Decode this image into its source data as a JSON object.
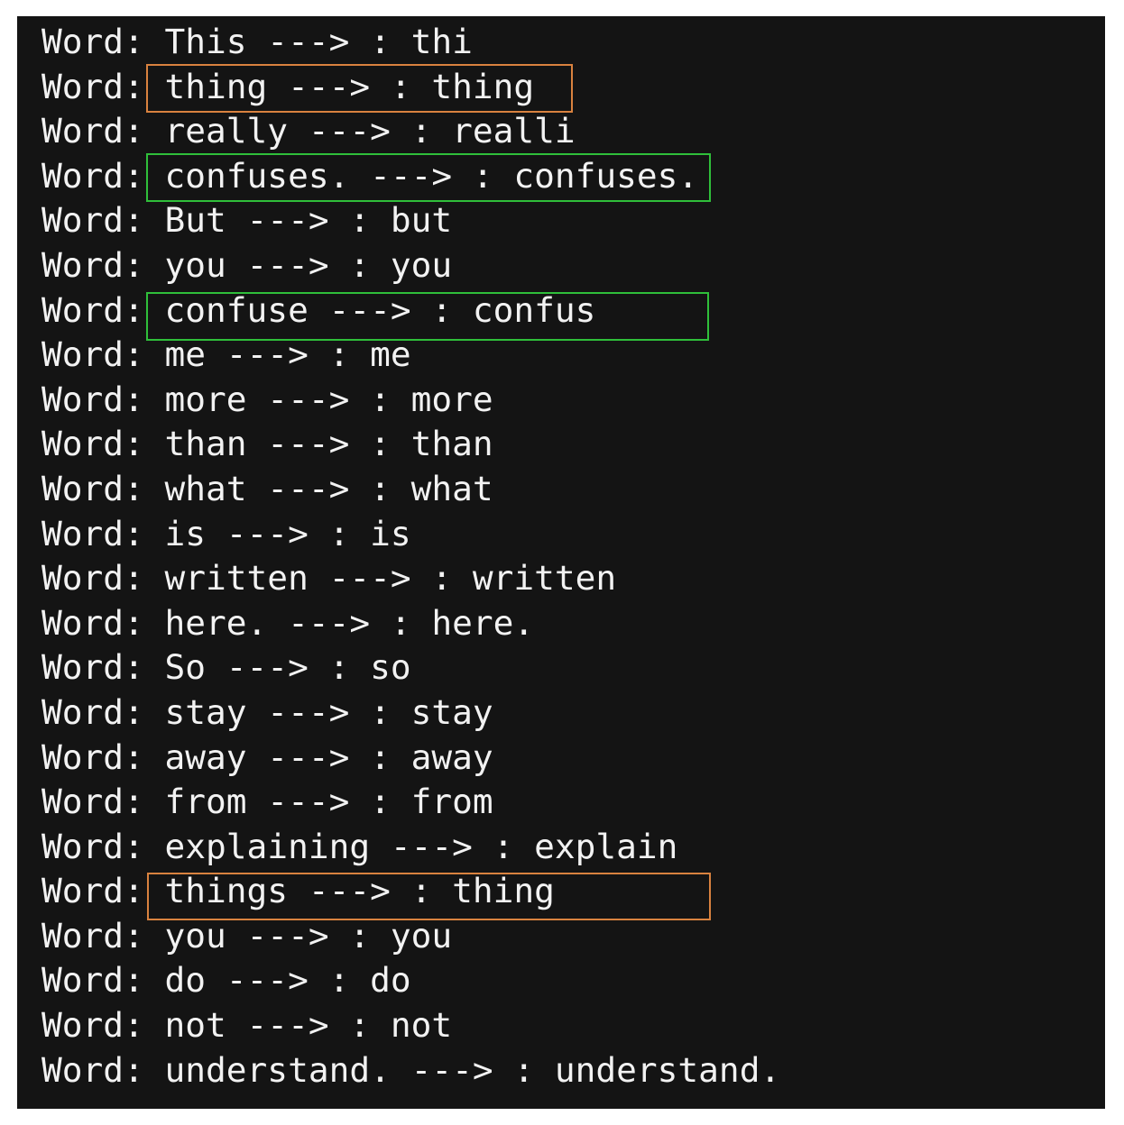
{
  "terminal": {
    "lines": [
      "Word: This ---> : thi",
      "Word: thing ---> : thing",
      "Word: really ---> : realli",
      "Word: confuses. ---> : confuses.",
      "Word: But ---> : but",
      "Word: you ---> : you",
      "Word: confuse ---> : confus",
      "Word: me ---> : me",
      "Word: more ---> : more",
      "Word: than ---> : than",
      "Word: what ---> : what",
      "Word: is ---> : is",
      "Word: written ---> : written",
      "Word: here. ---> : here.",
      "Word: So ---> : so",
      "Word: stay ---> : stay",
      "Word: away ---> : away",
      "Word: from ---> : from",
      "Word: explaining ---> : explain",
      "Word: things ---> : thing",
      "Word: you ---> : you",
      "Word: do ---> : do",
      "Word: not ---> : not",
      "Word: understand. ---> : understand."
    ]
  },
  "highlights": {
    "orange_color": "#d9823f",
    "green_color": "#2fbf3a"
  }
}
